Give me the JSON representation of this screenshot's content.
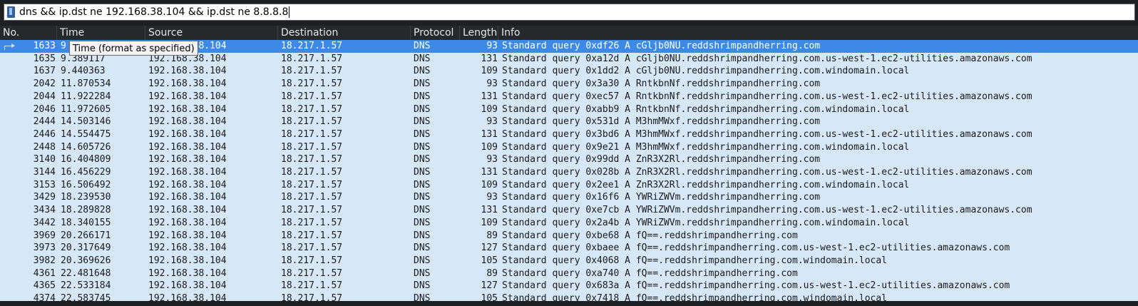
{
  "filter": {
    "value": "dns && ip.dst ne 192.168.38.104 && ip.dst ne 8.8.8.8"
  },
  "columns": [
    "No.",
    "Time",
    "Source",
    "Destination",
    "Protocol",
    "Length",
    "Info"
  ],
  "tooltip": "Time (format as specified)",
  "icons": {
    "bookmark": "bookmark-icon",
    "selected_row_marker": "arrow-icon"
  },
  "colors": {
    "row_bg": "#d6e8f8",
    "selected_bg": "#3d8ae6",
    "header_bg": "#26282b"
  },
  "selected_row_index": 0,
  "rows": [
    {
      "no": "1633",
      "time": "9",
      "source": "192.168.38.104",
      "destination": "18.217.1.57",
      "protocol": "DNS",
      "length": "93",
      "info": "Standard query 0xdf26 A cGljb0NU.reddshrimpandherring.com"
    },
    {
      "no": "1635",
      "time": "9.389117",
      "source": "192.168.38.104",
      "destination": "18.217.1.57",
      "protocol": "DNS",
      "length": "131",
      "info": "Standard query 0xa12d A cGljb0NU.reddshrimpandherring.com.us-west-1.ec2-utilities.amazonaws.com"
    },
    {
      "no": "1637",
      "time": "9.440363",
      "source": "192.168.38.104",
      "destination": "18.217.1.57",
      "protocol": "DNS",
      "length": "109",
      "info": "Standard query 0x1dd2 A cGljb0NU.reddshrimpandherring.com.windomain.local"
    },
    {
      "no": "2042",
      "time": "11.870534",
      "source": "192.168.38.104",
      "destination": "18.217.1.57",
      "protocol": "DNS",
      "length": "93",
      "info": "Standard query 0x3a30 A RntkbnNf.reddshrimpandherring.com"
    },
    {
      "no": "2044",
      "time": "11.922284",
      "source": "192.168.38.104",
      "destination": "18.217.1.57",
      "protocol": "DNS",
      "length": "131",
      "info": "Standard query 0xec57 A RntkbnNf.reddshrimpandherring.com.us-west-1.ec2-utilities.amazonaws.com"
    },
    {
      "no": "2046",
      "time": "11.972605",
      "source": "192.168.38.104",
      "destination": "18.217.1.57",
      "protocol": "DNS",
      "length": "109",
      "info": "Standard query 0xabb9 A RntkbnNf.reddshrimpandherring.com.windomain.local"
    },
    {
      "no": "2444",
      "time": "14.503146",
      "source": "192.168.38.104",
      "destination": "18.217.1.57",
      "protocol": "DNS",
      "length": "93",
      "info": "Standard query 0x531d A M3hmMWxf.reddshrimpandherring.com"
    },
    {
      "no": "2446",
      "time": "14.554475",
      "source": "192.168.38.104",
      "destination": "18.217.1.57",
      "protocol": "DNS",
      "length": "131",
      "info": "Standard query 0x3bd6 A M3hmMWxf.reddshrimpandherring.com.us-west-1.ec2-utilities.amazonaws.com"
    },
    {
      "no": "2448",
      "time": "14.605726",
      "source": "192.168.38.104",
      "destination": "18.217.1.57",
      "protocol": "DNS",
      "length": "109",
      "info": "Standard query 0x9e21 A M3hmMWxf.reddshrimpandherring.com.windomain.local"
    },
    {
      "no": "3140",
      "time": "16.404809",
      "source": "192.168.38.104",
      "destination": "18.217.1.57",
      "protocol": "DNS",
      "length": "93",
      "info": "Standard query 0x99dd A ZnR3X2Rl.reddshrimpandherring.com"
    },
    {
      "no": "3144",
      "time": "16.456229",
      "source": "192.168.38.104",
      "destination": "18.217.1.57",
      "protocol": "DNS",
      "length": "131",
      "info": "Standard query 0x028b A ZnR3X2Rl.reddshrimpandherring.com.us-west-1.ec2-utilities.amazonaws.com"
    },
    {
      "no": "3153",
      "time": "16.506492",
      "source": "192.168.38.104",
      "destination": "18.217.1.57",
      "protocol": "DNS",
      "length": "109",
      "info": "Standard query 0x2ee1 A ZnR3X2Rl.reddshrimpandherring.com.windomain.local"
    },
    {
      "no": "3429",
      "time": "18.239530",
      "source": "192.168.38.104",
      "destination": "18.217.1.57",
      "protocol": "DNS",
      "length": "93",
      "info": "Standard query 0x16f6 A YWRiZWVm.reddshrimpandherring.com"
    },
    {
      "no": "3434",
      "time": "18.289828",
      "source": "192.168.38.104",
      "destination": "18.217.1.57",
      "protocol": "DNS",
      "length": "131",
      "info": "Standard query 0xe7cb A YWRiZWVm.reddshrimpandherring.com.us-west-1.ec2-utilities.amazonaws.com"
    },
    {
      "no": "3442",
      "time": "18.340155",
      "source": "192.168.38.104",
      "destination": "18.217.1.57",
      "protocol": "DNS",
      "length": "109",
      "info": "Standard query 0x2a4b A YWRiZWVm.reddshrimpandherring.com.windomain.local"
    },
    {
      "no": "3969",
      "time": "20.266171",
      "source": "192.168.38.104",
      "destination": "18.217.1.57",
      "protocol": "DNS",
      "length": "89",
      "info": "Standard query 0xbe68 A fQ==.reddshrimpandherring.com"
    },
    {
      "no": "3973",
      "time": "20.317649",
      "source": "192.168.38.104",
      "destination": "18.217.1.57",
      "protocol": "DNS",
      "length": "127",
      "info": "Standard query 0xbaee A fQ==.reddshrimpandherring.com.us-west-1.ec2-utilities.amazonaws.com"
    },
    {
      "no": "3982",
      "time": "20.369626",
      "source": "192.168.38.104",
      "destination": "18.217.1.57",
      "protocol": "DNS",
      "length": "105",
      "info": "Standard query 0x4068 A fQ==.reddshrimpandherring.com.windomain.local"
    },
    {
      "no": "4361",
      "time": "22.481648",
      "source": "192.168.38.104",
      "destination": "18.217.1.57",
      "protocol": "DNS",
      "length": "89",
      "info": "Standard query 0xa740 A fQ==.reddshrimpandherring.com"
    },
    {
      "no": "4365",
      "time": "22.533184",
      "source": "192.168.38.104",
      "destination": "18.217.1.57",
      "protocol": "DNS",
      "length": "127",
      "info": "Standard query 0x683a A fQ==.reddshrimpandherring.com.us-west-1.ec2-utilities.amazonaws.com"
    },
    {
      "no": "4374",
      "time": "22.583745",
      "source": "192.168.38.104",
      "destination": "18.217.1.57",
      "protocol": "DNS",
      "length": "105",
      "info": "Standard query 0x7418 A fQ==.reddshrimpandherring.com.windomain.local"
    }
  ]
}
